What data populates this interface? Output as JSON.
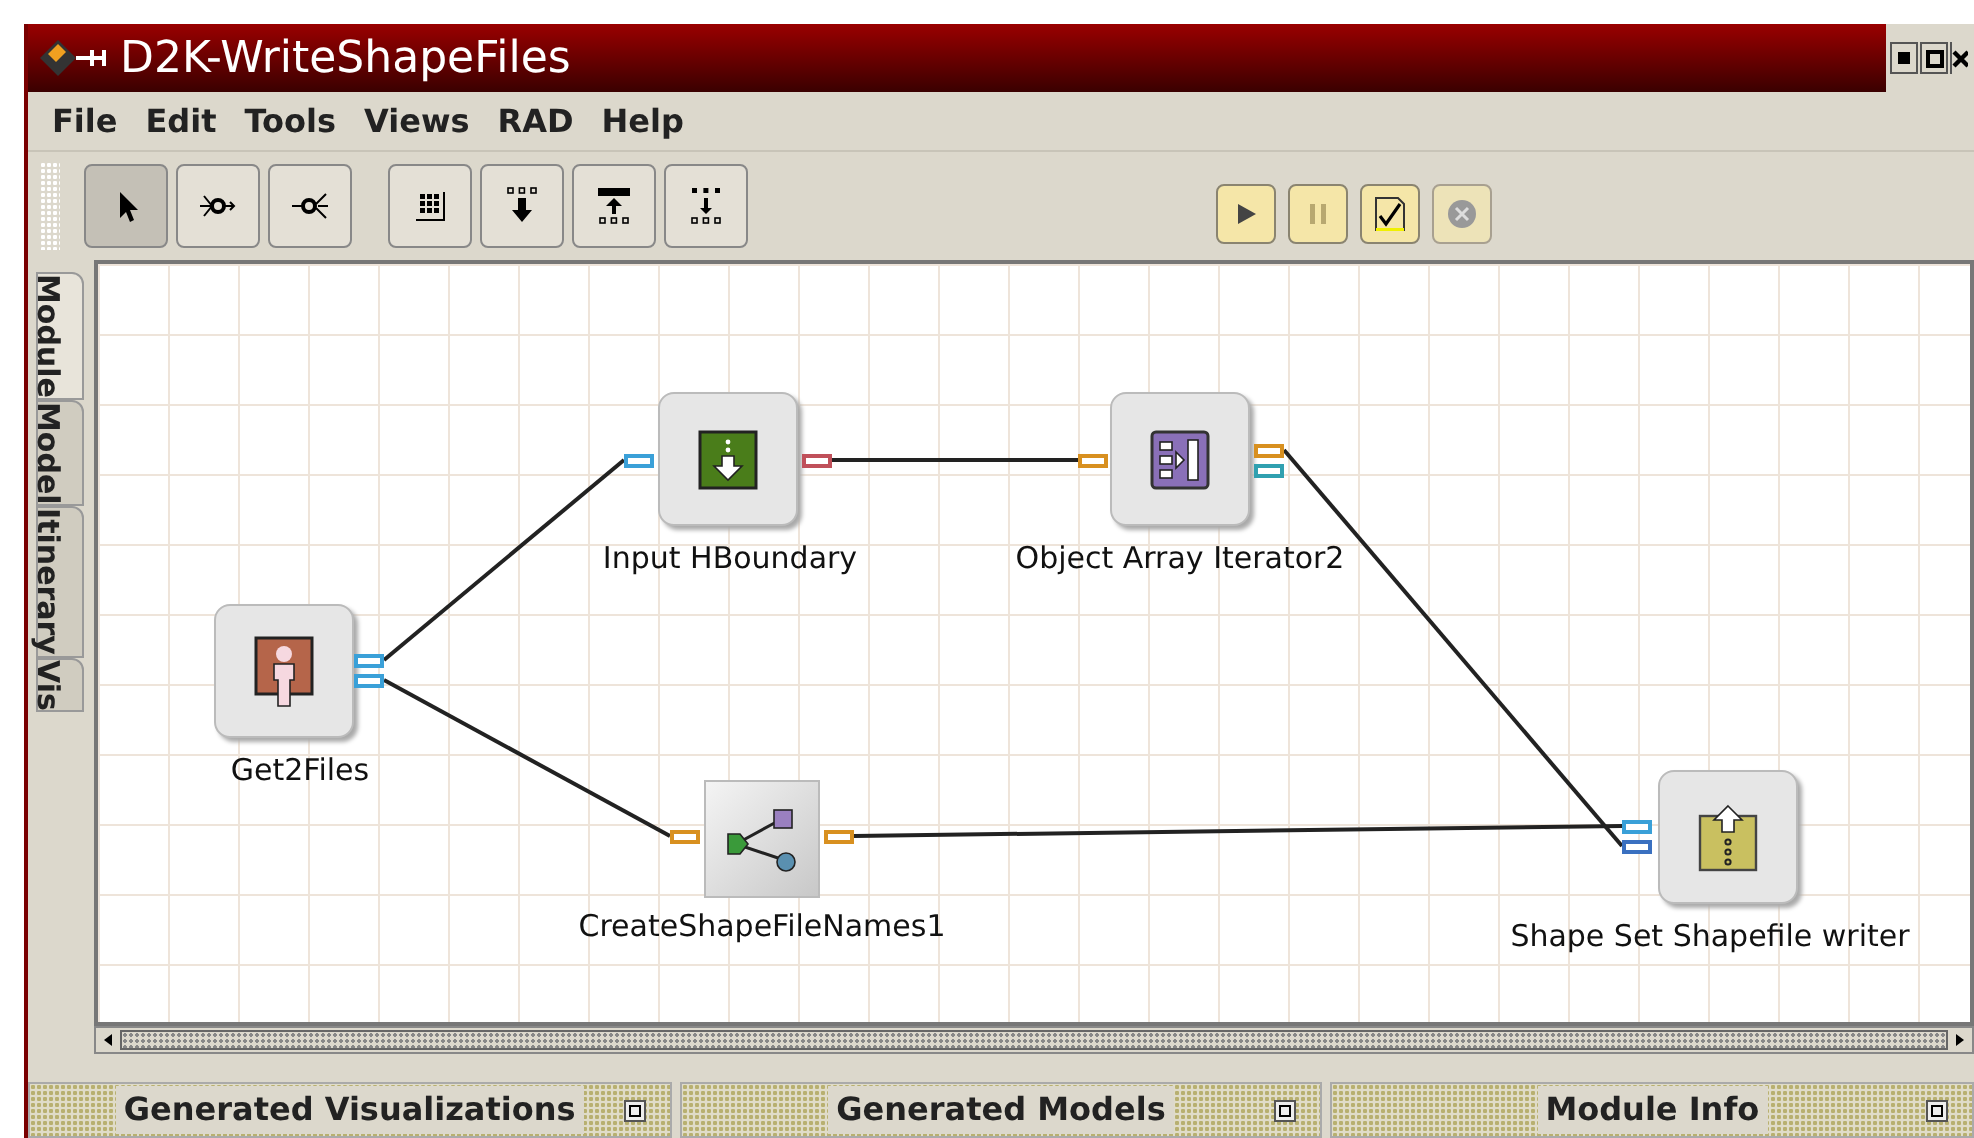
{
  "window": {
    "title": "D2K-WriteShapeFiles"
  },
  "menu": [
    "File",
    "Edit",
    "Tools",
    "Views",
    "RAD",
    "Help"
  ],
  "tools": [
    {
      "kind": "pointer",
      "selected": true
    },
    {
      "kind": "connect",
      "selected": false
    },
    {
      "kind": "fanout",
      "selected": false
    },
    {
      "kind": "grid",
      "selected": false
    },
    {
      "kind": "down",
      "selected": false
    },
    {
      "kind": "up",
      "selected": false
    },
    {
      "kind": "spread",
      "selected": false
    }
  ],
  "run_controls": [
    {
      "kind": "play",
      "disabled": false
    },
    {
      "kind": "pause",
      "disabled": false
    },
    {
      "kind": "check",
      "disabled": false
    },
    {
      "kind": "stop",
      "disabled": true
    }
  ],
  "side_tabs": [
    {
      "label": "Module",
      "selected": true
    },
    {
      "label": "Model",
      "selected": false
    },
    {
      "label": "Itinerary",
      "selected": false
    },
    {
      "label": "Vis",
      "selected": false
    }
  ],
  "nodes": [
    {
      "label": "Get2Files",
      "kind": "reader"
    },
    {
      "label": "Input HBoundary",
      "kind": "input"
    },
    {
      "label": "Object Array Iterator2",
      "kind": "iterator"
    },
    {
      "label": "CreateShapeFileNames1",
      "kind": "splitter"
    },
    {
      "label": "Shape Set Shapefile writer",
      "kind": "writer"
    }
  ],
  "panels": [
    "Generated Visualizations",
    "Generated Models",
    "Module Info"
  ]
}
